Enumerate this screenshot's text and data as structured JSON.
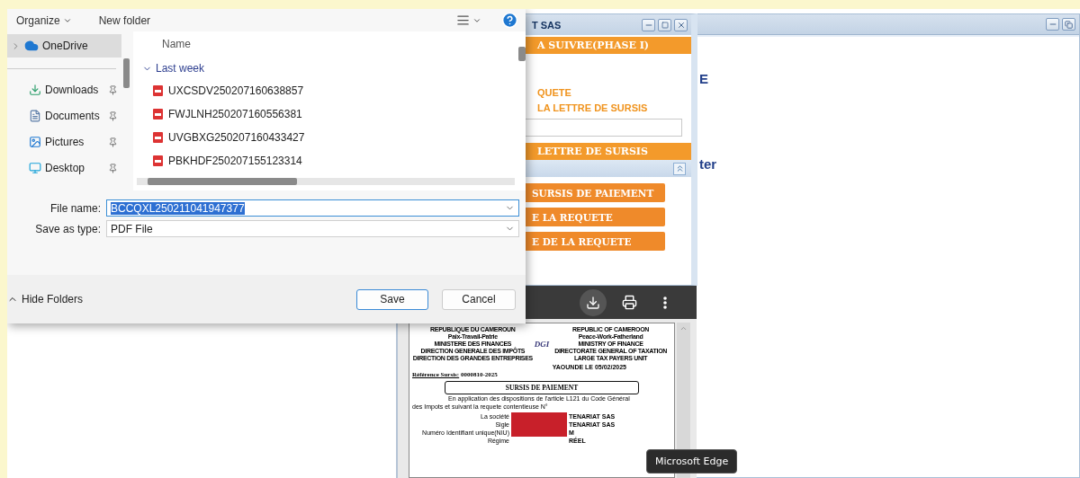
{
  "dialog": {
    "toolbar": {
      "organize": "Organize",
      "new_folder": "New folder"
    },
    "nav_items": [
      {
        "label": "OneDrive",
        "kind": "cloud",
        "selected": true,
        "pinned": false
      },
      {
        "label": "Downloads",
        "kind": "downloads",
        "selected": false,
        "pinned": true
      },
      {
        "label": "Documents",
        "kind": "documents",
        "selected": false,
        "pinned": true
      },
      {
        "label": "Pictures",
        "kind": "pictures",
        "selected": false,
        "pinned": true
      },
      {
        "label": "Desktop",
        "kind": "desktop",
        "selected": false,
        "pinned": true
      }
    ],
    "file_list": {
      "column": "Name",
      "group": {
        "label": "Last week",
        "expanded": true
      },
      "files": [
        "UXCSDV250207160638857",
        "FWJLNH250207160556381",
        "UVGBXG250207160433427",
        "PBKHDF250207155123314"
      ]
    },
    "file_name": {
      "label": "File name:",
      "value": "BCCQXL250211041947377",
      "selected": true
    },
    "save_as_type": {
      "label": "Save as type:",
      "value": "PDF File"
    },
    "hide_folders": "Hide Folders",
    "buttons": [
      {
        "label": "Save",
        "default": true
      },
      {
        "label": "Cancel",
        "default": false
      }
    ]
  },
  "inner_window": {
    "title": "T SAS",
    "header_bar": "A SUIVRE(PHASE I)",
    "links": [
      "QUETE",
      "LA LETTRE DE SURSIS"
    ],
    "section_bar": "LETTRE DE SURSIS",
    "actions": [
      "SURSIS DE PAIEMENT",
      "E LA REQUETE",
      "E DE LA REQUETE"
    ]
  },
  "main_window": {
    "texts": [
      "E",
      "ter"
    ]
  },
  "pdf_viewer": {
    "page": {
      "header_left": [
        "REPUBLIQUE DU CAMEROUN",
        "Paix-Travail-Patrie",
        "MINISTERE DES FINANCES",
        "DIRECTION GENERALE DES IMPÔTS",
        "DIRECTION DES GRANDES ENTREPRISES"
      ],
      "logo": "DGI",
      "header_right": [
        "REPUBLIC OF CAMEROON",
        "Peace-Work-Fatherland",
        "MINISTRY OF FINANCE",
        "DIRECTORATE GENERAL OF TAXATION",
        "LARGE TAX PAYERS UNIT"
      ],
      "date": "YAOUNDE LE 05/02/2025",
      "reference": {
        "label": "Référence Sursis:",
        "value": "0000810-2025"
      },
      "title": "SURSIS DE PAIEMENT",
      "paragraph": [
        "En application des dispositions de l'article L121  du Code Général",
        "des Impots  et suivant  la requete contentieuse N°"
      ],
      "fields": [
        {
          "label": "La société",
          "value": "TENARIAT SAS"
        },
        {
          "label": "Sigle",
          "value": "TENARIAT SAS"
        },
        {
          "label": "Numéro Identifiant unique(NIU)",
          "value": "M"
        },
        {
          "label": "Régime",
          "value": "RÉEL"
        }
      ]
    }
  },
  "tooltip": "Microsoft Edge"
}
